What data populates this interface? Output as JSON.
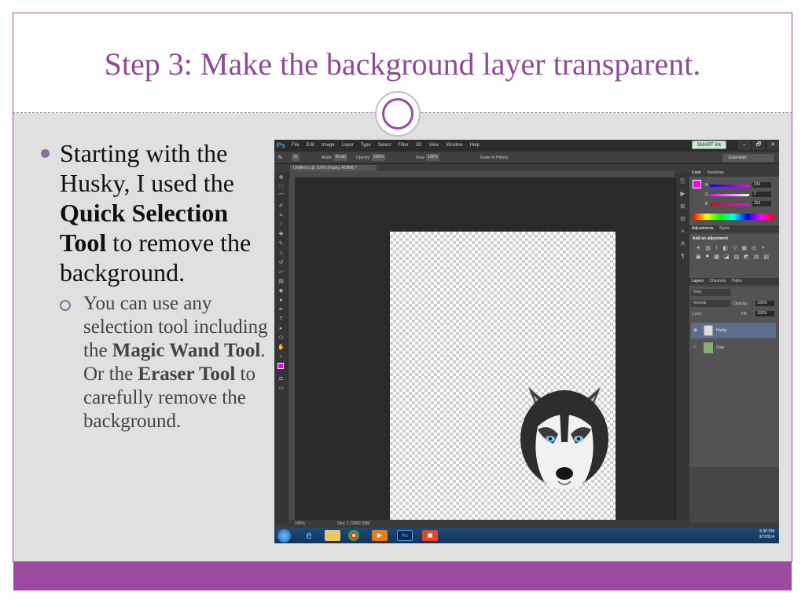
{
  "slide": {
    "title": "Step 3: Make the background layer transparent.",
    "bullet1_pre": "Starting with the Husky, I used the ",
    "bullet1_bold": "Quick Selection Tool",
    "bullet1_post": " to remove the background.",
    "bullet2_pre": "You can use any selection tool including the ",
    "bullet2_bold1": "Magic Wand Tool",
    "bullet2_mid": ". Or the ",
    "bullet2_bold2": "Eraser Tool",
    "bullet2_post": " to carefully remove the background.",
    "accent_color": "#9b4aa0"
  },
  "photoshop": {
    "logo": "Ps",
    "menus": [
      "File",
      "Edit",
      "Image",
      "Layer",
      "Type",
      "Select",
      "Filter",
      "3D",
      "View",
      "Window",
      "Help"
    ],
    "smart_ink": "SMART Ink",
    "window_controls": [
      "–",
      "🗗",
      "✕"
    ],
    "options": {
      "brush_size": "35",
      "mode_label": "Mode:",
      "mode_value": "Brush",
      "opacity_label": "Opacity:",
      "opacity_value": "100%",
      "flow_label": "Flow:",
      "flow_value": "100%",
      "erase_history": "Erase to History",
      "workspace": "Essentials"
    },
    "document_tab": "Untitled-1 @ 100% (Husky, RGB/8) *",
    "status_zoom": "100%",
    "status_doc": "Doc: 1.72M/2.29M",
    "color_panel": {
      "tabs": [
        "Color",
        "Swatches"
      ],
      "r_label": "R",
      "g_label": "G",
      "b_label": "B",
      "r": "243",
      "g": "2",
      "b": "253",
      "foreground": "#f300fd"
    },
    "adjustments_panel": {
      "tabs": [
        "Adjustments",
        "Styles"
      ],
      "title": "Add an adjustment"
    },
    "layers_panel": {
      "tabs": [
        "Layers",
        "Channels",
        "Paths"
      ],
      "kind": "Kind",
      "blend_mode": "Normal",
      "opacity_label": "Opacity:",
      "opacity_value": "100%",
      "lock_label": "Lock:",
      "fill_label": "Fill:",
      "fill_value": "100%",
      "layers": [
        "Husky",
        "Cow"
      ]
    },
    "taskbar": {
      "time": "5:30 PM",
      "date": "3/7/2014"
    }
  }
}
